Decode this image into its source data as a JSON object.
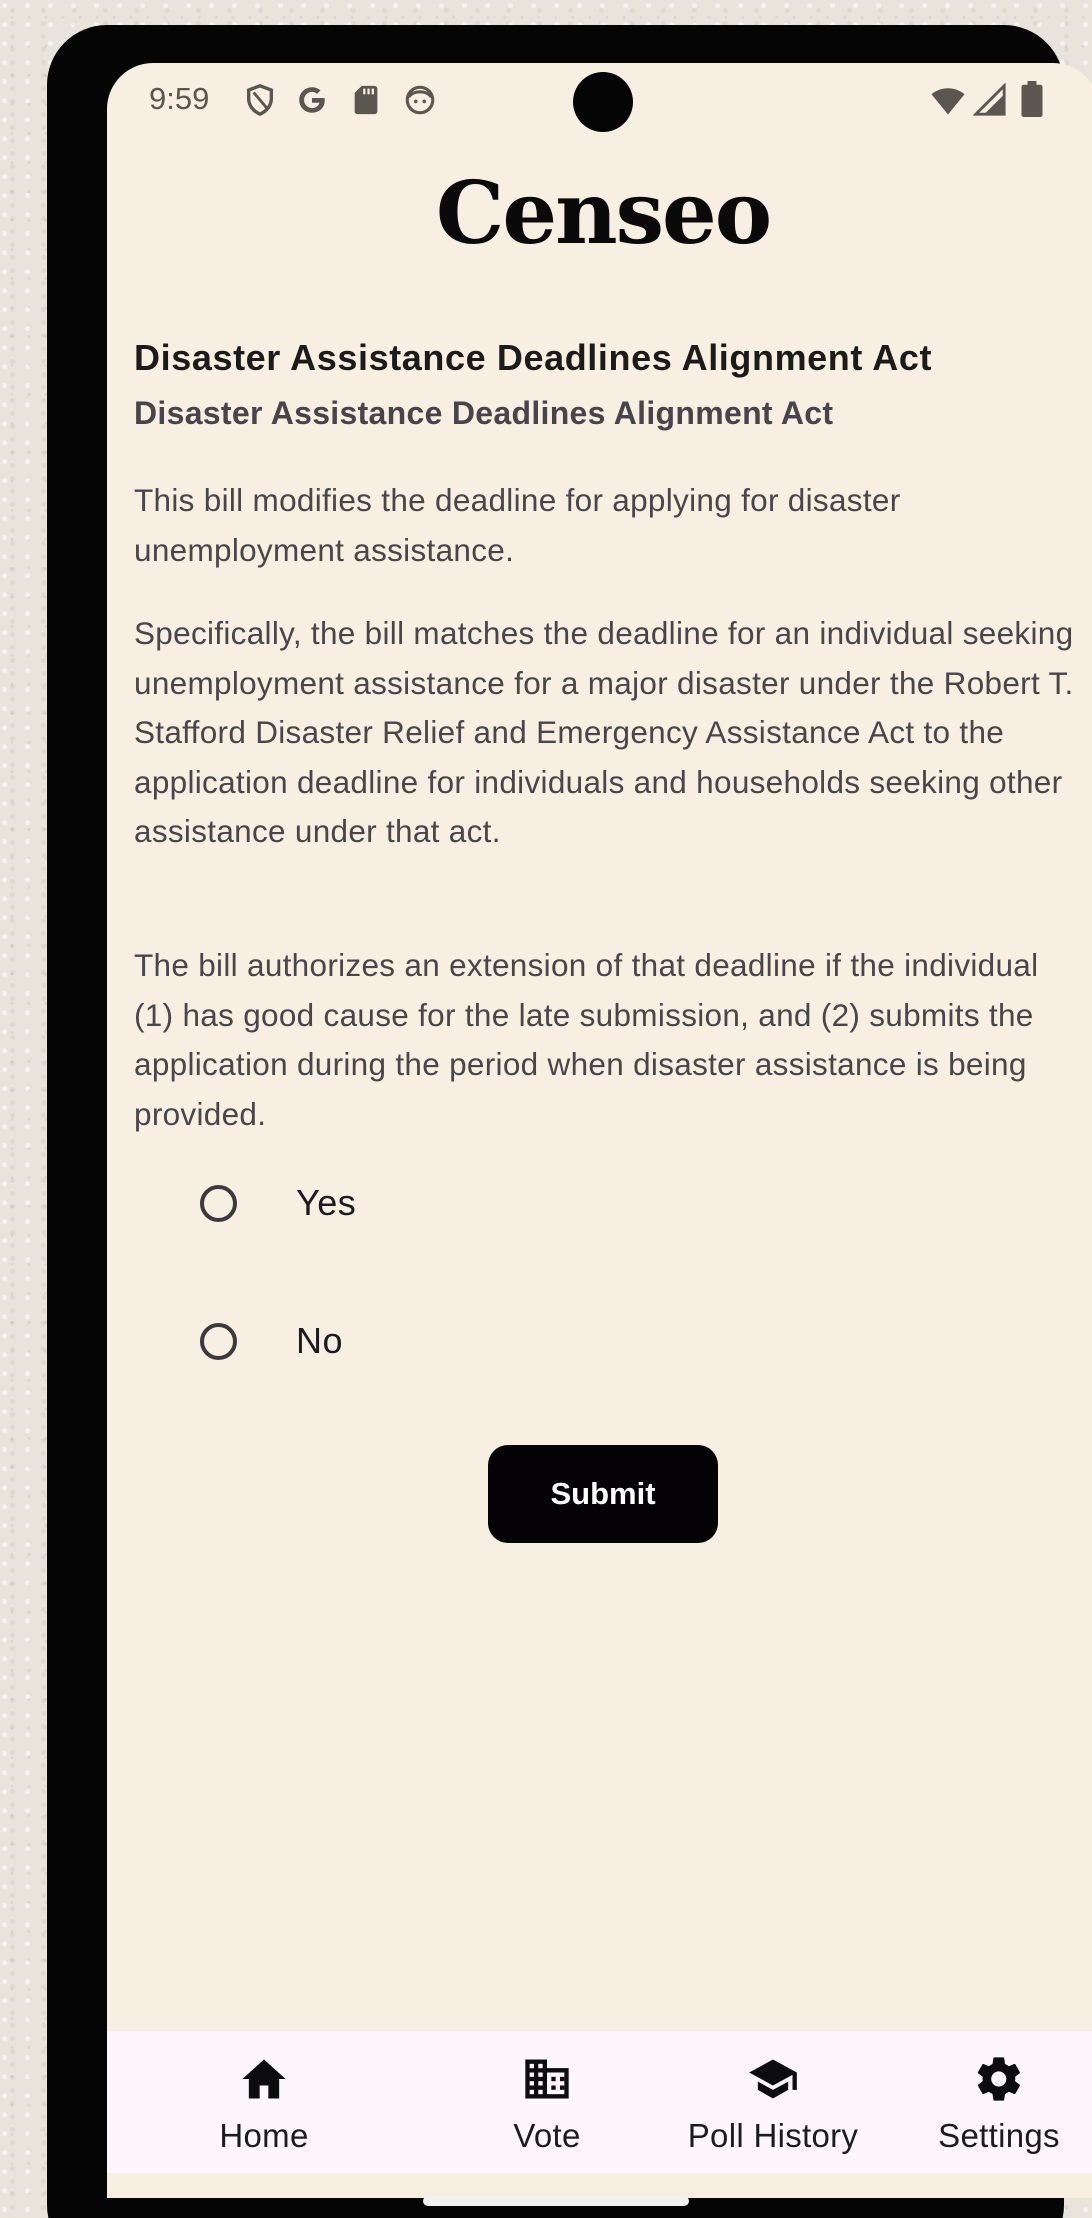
{
  "status_bar": {
    "time": "9:59",
    "left_icons": [
      "shield-icon",
      "google-icon",
      "sd-card-icon",
      "face-icon"
    ],
    "right_icons": [
      "wifi-icon",
      "signal-icon",
      "battery-icon"
    ]
  },
  "app": {
    "title": "Censeo"
  },
  "bill": {
    "title": "Disaster Assistance Deadlines Alignment Act",
    "subtitle": "Disaster Assistance Deadlines Alignment Act",
    "paragraphs": [
      "This bill modifies the deadline for applying for disaster unemployment assistance.",
      "Specifically, the bill matches the deadline for an individual seeking unemployment assistance for a major disaster under the Robert T. Stafford Disaster Relief and Emergency Assistance Act to the application deadline for individuals and households seeking other assistance under that act.",
      "The bill authorizes an extension of that deadline if the individual (1) has good cause for the late submission, and (2) submits the application during the period when disaster assistance is being provided."
    ]
  },
  "vote": {
    "options": [
      {
        "label": "Yes",
        "selected": false
      },
      {
        "label": "No",
        "selected": false
      }
    ],
    "submit_label": "Submit"
  },
  "bottom_nav": {
    "items": [
      {
        "label": "Home",
        "icon": "home-icon"
      },
      {
        "label": "Vote",
        "icon": "building-icon"
      },
      {
        "label": "Poll History",
        "icon": "graduation-cap-icon"
      },
      {
        "label": "Settings",
        "icon": "gear-icon"
      }
    ]
  },
  "colors": {
    "background": "#f7efe2",
    "button": "#050205",
    "nav_background": "#fdf7fd",
    "text": "#4a4548"
  }
}
